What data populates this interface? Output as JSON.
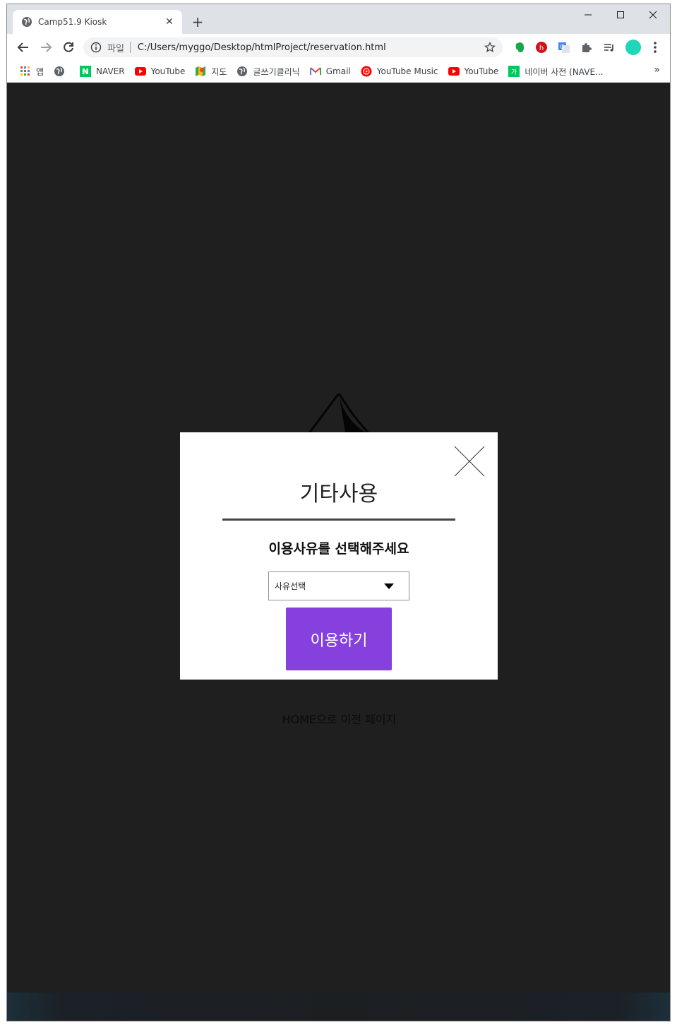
{
  "browser": {
    "tab": {
      "title": "Camp51.9 Kiosk"
    },
    "address_bar": {
      "scheme_label": "파일",
      "url": "C:/Users/myggo/Desktop/htmlProject/reservation.html"
    },
    "bookmarks": [
      {
        "label": "앱",
        "icon": "apps-grid-icon"
      },
      {
        "label": "",
        "icon": "globe-icon"
      },
      {
        "label": "NAVER",
        "icon": "naver-icon"
      },
      {
        "label": "YouTube",
        "icon": "youtube-icon"
      },
      {
        "label": "지도",
        "icon": "maps-icon"
      },
      {
        "label": "글쓰기클리닉",
        "icon": "globe-icon"
      },
      {
        "label": "Gmail",
        "icon": "gmail-icon"
      },
      {
        "label": "YouTube Music",
        "icon": "youtube-music-icon"
      },
      {
        "label": "YouTube",
        "icon": "youtube-icon"
      },
      {
        "label": "네이버 사전 (NAVE...",
        "icon": "naver-dictionary-icon"
      }
    ],
    "more_bookmarks": "»",
    "profile_color": "#1ed6b8"
  },
  "page": {
    "home_link": "HOME으로 이전 페이지",
    "modal": {
      "title": "기타사용",
      "prompt": "이용사유를 선택해주세요",
      "select": {
        "selected": "사유선택"
      },
      "submit_label": "이용하기",
      "accent_color": "#8540dd"
    }
  }
}
